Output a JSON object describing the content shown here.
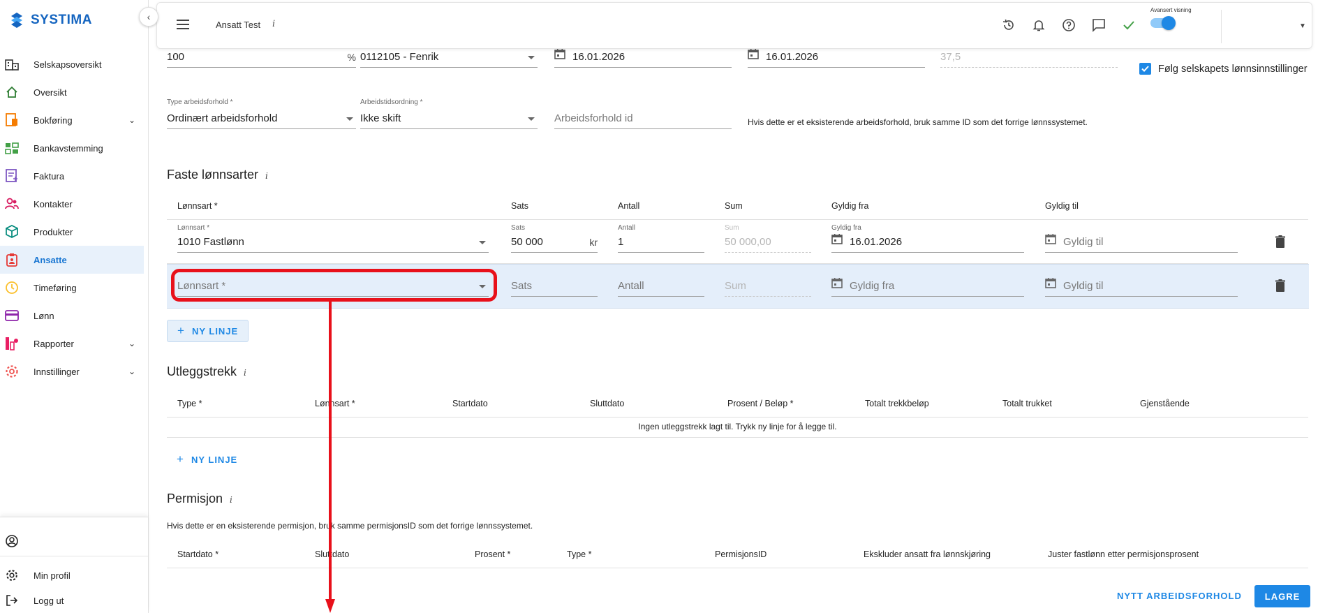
{
  "brand": {
    "name": "SYSTIMA",
    "color": "#1565c0"
  },
  "sidebar": {
    "collapse_icon": "chevron-left-icon",
    "items": [
      {
        "label": "Selskapsoversikt",
        "icon": "company-overview-icon",
        "color": "#333"
      },
      {
        "label": "Oversikt",
        "icon": "home-icon",
        "color": "#2e7d32"
      },
      {
        "label": "Bokføring",
        "icon": "bookkeeping-icon",
        "color": "#f57c00",
        "expandable": true
      },
      {
        "label": "Bankavstemming",
        "icon": "bank-reconciliation-icon",
        "color": "#43a047"
      },
      {
        "label": "Faktura",
        "icon": "invoice-icon",
        "color": "#7e57c2"
      },
      {
        "label": "Kontakter",
        "icon": "contacts-icon",
        "color": "#d81b60"
      },
      {
        "label": "Produkter",
        "icon": "products-icon",
        "color": "#00897b"
      },
      {
        "label": "Ansatte",
        "icon": "employees-icon",
        "color": "#e53935",
        "active": true
      },
      {
        "label": "Timeføring",
        "icon": "time-tracking-icon",
        "color": "#fbc02d"
      },
      {
        "label": "Lønn",
        "icon": "payroll-icon",
        "color": "#8e24aa"
      },
      {
        "label": "Rapporter",
        "icon": "reports-icon",
        "color": "#e91e63",
        "expandable": true
      },
      {
        "label": "Innstillinger",
        "icon": "settings-icon",
        "color": "#ef5350",
        "expandable": true
      }
    ],
    "bottom": [
      {
        "label": "",
        "icon": "user-circle-icon"
      },
      {
        "label": "Min profil",
        "icon": "gear-icon"
      },
      {
        "label": "Logg ut",
        "icon": "logout-icon"
      }
    ]
  },
  "header": {
    "title": "Ansatt Test",
    "info": "i",
    "toggle_label": "Avansert visning",
    "toggle_on": true,
    "icons": [
      "history-icon",
      "bell-icon",
      "help-icon",
      "chat-icon",
      "check-icon"
    ]
  },
  "top_fields": {
    "stillingsprosent": {
      "value": "100",
      "suffix": "%"
    },
    "yrkeskode": {
      "value": "0112105 - Fenrik"
    },
    "startdato": {
      "value": "16.01.2026"
    },
    "siste_endring": {
      "value": "16.01.2026"
    },
    "timer": {
      "value": "37,5"
    },
    "follow_settings": {
      "label": "Følg selskapets lønnsinnstillinger",
      "checked": true
    },
    "type_arbeidsforhold": {
      "label": "Type arbeidsforhold *",
      "value": "Ordinært arbeidsforhold"
    },
    "arbeidstidsordning": {
      "label": "Arbeidstidsordning *",
      "value": "Ikke skift"
    },
    "arbeidsforhold_id": {
      "placeholder": "Arbeidsforhold id"
    },
    "id_hint": "Hvis dette er et eksisterende arbeidsforhold, bruk samme ID som det forrige lønnssystemet."
  },
  "faste": {
    "title": "Faste lønnsarter",
    "info": "i",
    "headers": [
      "Lønnsart *",
      "Sats",
      "Antall",
      "Sum",
      "Gyldig fra",
      "Gyldig til"
    ],
    "row1": {
      "lonnsart_label": "Lønnsart *",
      "lonnsart": "1010 Fastlønn",
      "sats_label": "Sats",
      "sats": "50 000",
      "sats_suffix": "kr",
      "antall_label": "Antall",
      "antall": "1",
      "sum_label": "Sum",
      "sum": "50 000,00",
      "fra_label": "Gyldig fra",
      "fra": "16.01.2026",
      "til": "Gyldig til"
    },
    "row2": {
      "lonnsart": "Lønnsart *",
      "sats": "Sats",
      "antall": "Antall",
      "sum": "Sum",
      "fra": "Gyldig fra",
      "til": "Gyldig til"
    },
    "new_line": "NY LINJE"
  },
  "utlegg": {
    "title": "Utleggstrekk",
    "info": "i",
    "headers": [
      "Type *",
      "Lønnsart *",
      "Startdato",
      "Sluttdato",
      "Prosent / Beløp *",
      "Totalt trekkbeløp",
      "Totalt trukket",
      "Gjenstående"
    ],
    "empty": "Ingen utleggstrekk lagt til. Trykk ny linje for å legge til.",
    "new_line": "NY LINJE"
  },
  "permisjon": {
    "title": "Permisjon",
    "info": "i",
    "hint": "Hvis dette er en eksisterende permisjon, bruk samme permisjonsID som det forrige lønnssystemet.",
    "headers": [
      "Startdato *",
      "Sluttdato",
      "Prosent *",
      "Type *",
      "PermisjonsID",
      "Ekskluder ansatt fra lønnskjøring",
      "Juster fastlønn etter permisjonsprosent"
    ]
  },
  "footer": {
    "new_employment": "NYTT ARBEIDSFORHOLD",
    "save": "LAGRE"
  },
  "colors": {
    "accent": "#1e88e5",
    "annotation": "#e8101a",
    "active_row": "#e4eefa"
  }
}
